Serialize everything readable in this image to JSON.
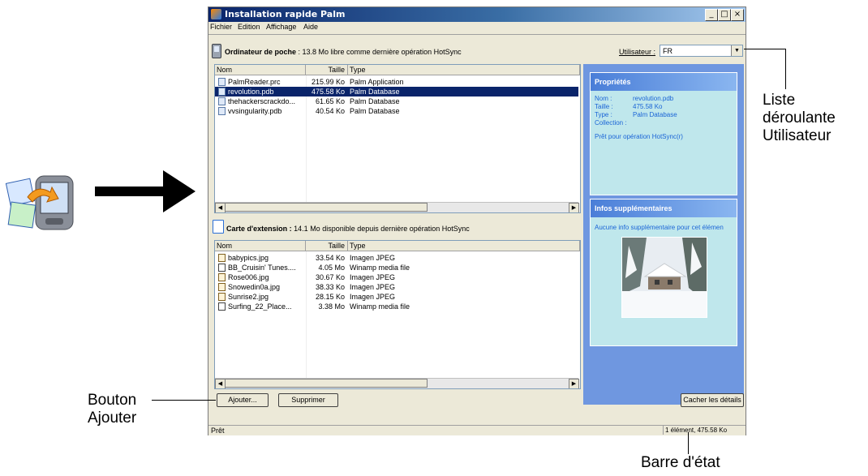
{
  "window": {
    "title": "Installation rapide Palm",
    "caption_buttons": [
      "_",
      "□",
      "×"
    ]
  },
  "menu": [
    "Fichier",
    "Edition",
    "Affichage",
    "Aide"
  ],
  "handheld": {
    "label": "Ordinateur de poche",
    "info": " : 13.8 Mo libre comme dernière opération HotSync",
    "icon": "handheld-icon"
  },
  "user": {
    "label": "Utilisateur :",
    "value": "FR"
  },
  "list_columns": [
    "Nom",
    "Taille",
    "Type"
  ],
  "handheld_files": [
    {
      "name": "PalmReader.prc",
      "size": "215.99 Ko",
      "type": "Palm Application"
    },
    {
      "name": "revolution.pdb",
      "size": "475.58 Ko",
      "type": "Palm Database",
      "selected": true
    },
    {
      "name": "thehackerscrackdo...",
      "size": "61.65 Ko",
      "type": "Palm Database"
    },
    {
      "name": "vvsingularity.pdb",
      "size": "40.54 Ko",
      "type": "Palm Database"
    }
  ],
  "card": {
    "label": "Carte d'extension :",
    "info": " 14.1 Mo disponible depuis dernière opération HotSync"
  },
  "card_files": [
    {
      "name": "babypics.jpg",
      "size": "33.54 Ko",
      "type": "Imagen JPEG",
      "icon": "image"
    },
    {
      "name": "BB_Cruisin' Tunes....",
      "size": "4.05 Mo",
      "type": "Winamp media file",
      "icon": "media"
    },
    {
      "name": "Rose006.jpg",
      "size": "30.67 Ko",
      "type": "Imagen JPEG",
      "icon": "image"
    },
    {
      "name": "Snowedin0a.jpg",
      "size": "38.33 Ko",
      "type": "Imagen JPEG",
      "icon": "image"
    },
    {
      "name": "Sunrise2.jpg",
      "size": "28.15 Ko",
      "type": "Imagen JPEG",
      "icon": "image"
    },
    {
      "name": "Surfing_22_Place...",
      "size": "3.38 Mo",
      "type": "Winamp media file",
      "icon": "media"
    }
  ],
  "properties": {
    "heading": "Propriétés",
    "rows": [
      {
        "k": "Nom :",
        "v": "revolution.pdb"
      },
      {
        "k": "Taille :",
        "v": "475.58 Ko"
      },
      {
        "k": "Type :",
        "v": "Palm Database"
      },
      {
        "k": "Collection :",
        "v": ""
      }
    ],
    "status": "Prêt pour opération HotSync(r)"
  },
  "extra": {
    "heading": "Infos supplémentaires",
    "text": "Aucune info supplémentaire pour cet élémen"
  },
  "buttons": {
    "add": "Ajouter...",
    "remove": "Supprimer",
    "hide_details": "Cacher les détails"
  },
  "status": {
    "left": "Prêt",
    "right": "1 élément, 475.58 Ko"
  },
  "callouts": {
    "user_list": [
      "Liste",
      "déroulante",
      "Utilisateur"
    ],
    "add_button": [
      "Bouton",
      "Ajouter"
    ],
    "status_bar": "Barre d'état"
  },
  "colors": {
    "selection": "#0a246a",
    "details_pane": "#6f97e0",
    "panel_text": "#1a64d6"
  }
}
